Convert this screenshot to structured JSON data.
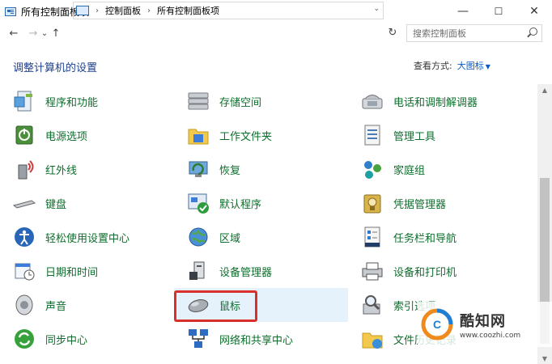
{
  "window": {
    "title": "所有控制面板项",
    "controls": {
      "minimize": "—",
      "maximize": "☐",
      "close": "✕"
    }
  },
  "nav": {
    "back": "←",
    "forward": "→",
    "recent": "⌄",
    "up": "↑",
    "breadcrumbs": [
      "控制面板",
      "所有控制面板项"
    ],
    "separator": "›",
    "dropdown": "⌄",
    "refresh": "↻",
    "search_placeholder": "搜索控制面板"
  },
  "header": {
    "title": "调整计算机的设置",
    "view_by_label": "查看方式:",
    "view_by_value": "大图标",
    "view_by_caret": "▼"
  },
  "items": [
    {
      "label": "程序和功能",
      "icon": "programs-features-icon"
    },
    {
      "label": "存储空间",
      "icon": "storage-spaces-icon"
    },
    {
      "label": "电话和调制解调器",
      "icon": "phone-modem-icon"
    },
    {
      "label": "电源选项",
      "icon": "power-options-icon"
    },
    {
      "label": "工作文件夹",
      "icon": "work-folders-icon"
    },
    {
      "label": "管理工具",
      "icon": "admin-tools-icon"
    },
    {
      "label": "红外线",
      "icon": "infrared-icon"
    },
    {
      "label": "恢复",
      "icon": "recovery-icon"
    },
    {
      "label": "家庭组",
      "icon": "homegroup-icon"
    },
    {
      "label": "键盘",
      "icon": "keyboard-icon"
    },
    {
      "label": "默认程序",
      "icon": "default-programs-icon"
    },
    {
      "label": "凭据管理器",
      "icon": "credential-manager-icon"
    },
    {
      "label": "轻松使用设置中心",
      "icon": "ease-of-access-icon"
    },
    {
      "label": "区域",
      "icon": "region-icon"
    },
    {
      "label": "任务栏和导航",
      "icon": "taskbar-icon"
    },
    {
      "label": "日期和时间",
      "icon": "date-time-icon"
    },
    {
      "label": "设备管理器",
      "icon": "device-manager-icon"
    },
    {
      "label": "设备和打印机",
      "icon": "devices-printers-icon"
    },
    {
      "label": "声音",
      "icon": "sound-icon"
    },
    {
      "label": "鼠标",
      "icon": "mouse-icon"
    },
    {
      "label": "索引选项",
      "icon": "indexing-icon"
    },
    {
      "label": "同步中心",
      "icon": "sync-center-icon"
    },
    {
      "label": "网络和共享中心",
      "icon": "network-sharing-icon"
    },
    {
      "label": "文件历史记录",
      "icon": "file-history-icon"
    }
  ],
  "highlighted_item": "鼠标",
  "scrollbar": {
    "up": "▲",
    "down": "▼"
  },
  "watermark": {
    "name": "酷知网",
    "url": "www.coozhi.com"
  },
  "colors": {
    "link_green": "#0e6e2d",
    "title_blue": "#1e3f8f",
    "highlight": "#e5f1fb",
    "callout_red": "#d9302e"
  }
}
